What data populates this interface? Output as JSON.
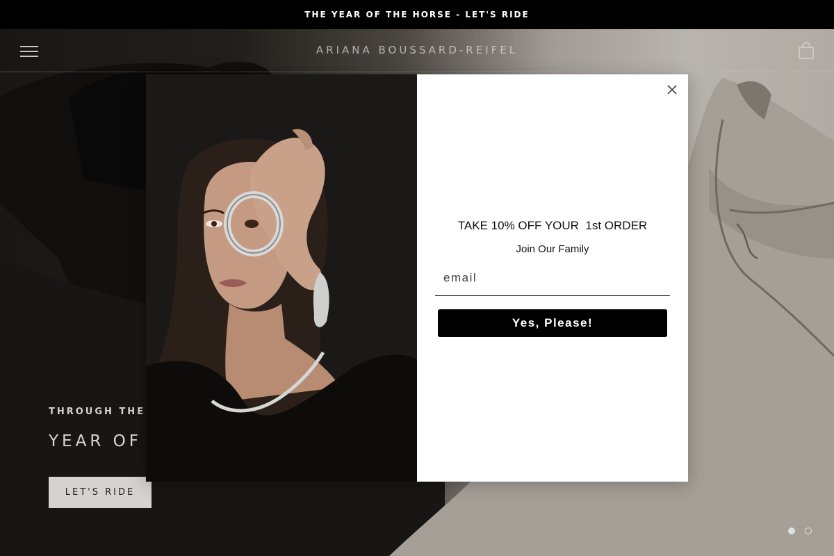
{
  "announcement": {
    "text": "THE YEAR OF THE HORSE - LET'S RIDE"
  },
  "header": {
    "logo": "ARIANA BOUSSARD-REIFEL",
    "menu_icon": "hamburger-menu-icon",
    "cart_icon": "shopping-bag-icon"
  },
  "hero": {
    "subtitle": "THROUGH THE LE",
    "title": "YEAR OF",
    "cta_label": "LET'S RIDE",
    "slides": {
      "count": 2,
      "active": 1
    }
  },
  "popup": {
    "close_icon": "close-icon",
    "title": "TAKE 10% OFF YOUR  1st ORDER",
    "subtitle": "Join Our Family",
    "email_placeholder": "email",
    "submit_label": "Yes, Please!"
  },
  "colors": {
    "announcement_bg": "#000000",
    "popup_bg": "#ffffff",
    "button_bg": "#000000",
    "button_text": "#ffffff"
  }
}
